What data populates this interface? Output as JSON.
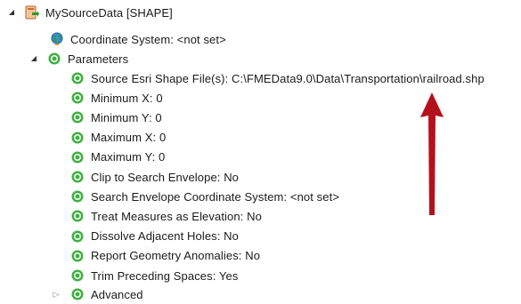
{
  "tree": {
    "root": {
      "label": "MySourceData [SHAPE]",
      "icon": "reader-dataset-icon"
    },
    "coordinate_system": {
      "label": "Coordinate System: <not set>",
      "icon": "globe-icon"
    },
    "parameters": {
      "label": "Parameters",
      "icon": "gear-icon",
      "items": [
        {
          "label": "Source Esri Shape File(s): C:\\FMEData9.0\\Data\\Transportation\\railroad.shp"
        },
        {
          "label": "Minimum X: 0"
        },
        {
          "label": "Minimum Y: 0"
        },
        {
          "label": "Maximum X: 0"
        },
        {
          "label": "Maximum Y: 0"
        },
        {
          "label": "Clip to Search Envelope: No"
        },
        {
          "label": "Search Envelope Coordinate System: <not set>"
        },
        {
          "label": "Treat Measures as Elevation: No"
        },
        {
          "label": "Dissolve Adjacent Holes: No"
        },
        {
          "label": "Report Geometry Anomalies: No"
        },
        {
          "label": "Trim Preceding Spaces: Yes"
        }
      ]
    },
    "advanced": {
      "label": "Advanced",
      "icon": "gear-icon"
    }
  },
  "colors": {
    "gear": "#3fb13f",
    "arrow": "#b3121d",
    "reader": "#d26a2a"
  }
}
